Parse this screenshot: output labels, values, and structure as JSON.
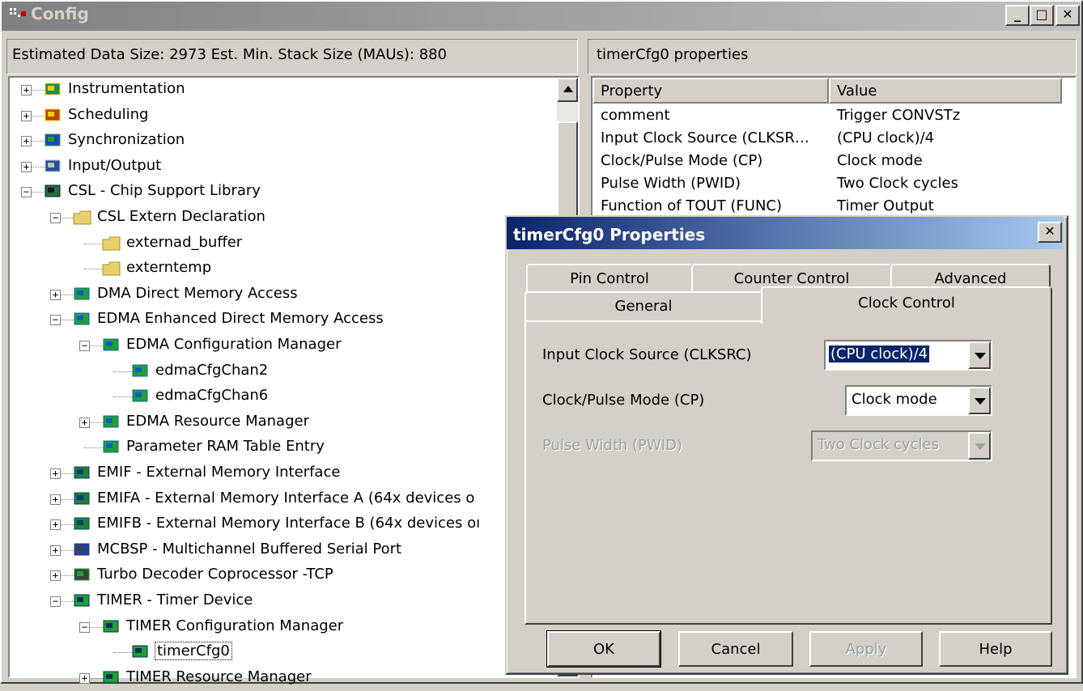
{
  "window": {
    "title": "Config",
    "minimize_label": "_",
    "maximize_label": "□",
    "close_label": "✕"
  },
  "left_status": {
    "text": "Estimated Data Size: 2973   Est. Min. Stack Size (MAUs): 880"
  },
  "tree": {
    "nodes": [
      {
        "label": "Instrumentation",
        "icon": "instrumentation-icon"
      },
      {
        "label": "Scheduling",
        "icon": "scheduling-icon"
      },
      {
        "label": "Synchronization",
        "icon": "synchronization-icon"
      },
      {
        "label": "Input/Output",
        "icon": "input-output-icon"
      },
      {
        "label": "CSL - Chip Support Library",
        "icon": "chip-icon"
      },
      {
        "label": "CSL Extern Declaration",
        "icon": "folder-icon"
      },
      {
        "label": "externad_buffer",
        "icon": "folder-icon"
      },
      {
        "label": "externtemp",
        "icon": "folder-icon"
      },
      {
        "label": "DMA Direct Memory Access",
        "icon": "dma-icon"
      },
      {
        "label": "EDMA Enhanced Direct Memory Access",
        "icon": "edma-icon"
      },
      {
        "label": "EDMA Configuration Manager",
        "icon": "edma-icon"
      },
      {
        "label": "edmaCfgChan2",
        "icon": "edma-icon"
      },
      {
        "label": "edmaCfgChan6",
        "icon": "edma-icon"
      },
      {
        "label": "EDMA Resource Manager",
        "icon": "edma-icon"
      },
      {
        "label": "Parameter RAM Table Entry",
        "icon": "edma-icon"
      },
      {
        "label": "EMIF - External Memory Interface",
        "icon": "emif-icon"
      },
      {
        "label": "EMIFA - External Memory Interface A (64x devices o",
        "icon": "emif-icon"
      },
      {
        "label": "EMIFB - External Memory Interface B (64x devices oı",
        "icon": "emif-icon"
      },
      {
        "label": "MCBSP - Multichannel Buffered Serial Port",
        "icon": "mcbsp-icon"
      },
      {
        "label": "Turbo Decoder Coprocessor -TCP",
        "icon": "tcp-icon"
      },
      {
        "label": "TIMER - Timer Device",
        "icon": "timer-icon"
      },
      {
        "label": "TIMER Configuration Manager",
        "icon": "timer-icon"
      },
      {
        "label": "timerCfg0",
        "icon": "timer-icon"
      },
      {
        "label": "TIMER Resource Manager",
        "icon": "timer-icon"
      }
    ]
  },
  "right_status": {
    "text": "timerCfg0 properties"
  },
  "properties": {
    "header_property": "Property",
    "header_value": "Value",
    "rows": [
      {
        "property": "comment",
        "value": "Trigger CONVSTz"
      },
      {
        "property": "Input Clock Source (CLKSR…",
        "value": "(CPU clock)/4"
      },
      {
        "property": "Clock/Pulse Mode (CP)",
        "value": "Clock mode"
      },
      {
        "property": "Pulse Width (PWID)",
        "value": "Two Clock cycles"
      },
      {
        "property": "Function of TOUT (FUNC)",
        "value": "Timer Output"
      }
    ]
  },
  "dialog": {
    "title": "timerCfg0 Properties",
    "close_label": "✕",
    "tabs_back": [
      "Pin Control",
      "Counter Control",
      "Advanced"
    ],
    "tabs_front": [
      "General",
      "Clock Control"
    ],
    "active_tab": "Clock Control",
    "fields": [
      {
        "label": "Input Clock Source (CLKSRC)",
        "value": "(CPU clock)/4",
        "enabled": true
      },
      {
        "label": "Clock/Pulse Mode (CP)",
        "value": "Clock mode",
        "enabled": true
      },
      {
        "label": "Pulse Width (PWID)",
        "value": "Two Clock cycles",
        "enabled": false
      }
    ],
    "buttons": {
      "ok": "OK",
      "cancel": "Cancel",
      "apply": "Apply",
      "help": "Help"
    }
  },
  "colors": {
    "title_active": "#0a246a",
    "title_inactive": "#808080",
    "face": "#d4d0c8",
    "selection": "#0a246a"
  }
}
